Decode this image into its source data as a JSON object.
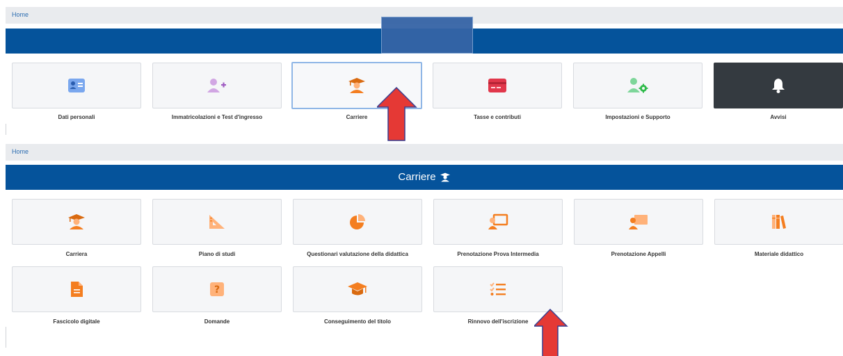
{
  "colors": {
    "header_blue": "#05539b",
    "orange": "#f47e20",
    "purple_accent": "#c58fd8",
    "red_card": "#e1374b",
    "green_gear": "#2fba4a",
    "dark_tile": "#343a40",
    "arrow_red": "#e53935"
  },
  "top": {
    "breadcrumb": "Home",
    "tiles": [
      {
        "label": "Dati personali",
        "icon": "id-card-icon"
      },
      {
        "label": "Immatricolazioni e Test d'ingresso",
        "icon": "add-user-icon"
      },
      {
        "label": "Carriere",
        "icon": "graduate-icon"
      },
      {
        "label": "Tasse e contributi",
        "icon": "credit-card-icon"
      },
      {
        "label": "Impostazioni e Supporto",
        "icon": "user-gear-icon"
      },
      {
        "label": "Avvisi",
        "icon": "bell-icon"
      }
    ]
  },
  "bottom": {
    "breadcrumb": "Home",
    "header_title": "Carriere",
    "row1": [
      {
        "label": "Carriera",
        "icon": "graduate-icon"
      },
      {
        "label": "Piano di studi",
        "icon": "set-square-icon"
      },
      {
        "label": "Questionari valutazione della didattica",
        "icon": "pie-chart-icon"
      },
      {
        "label": "Prenotazione Prova Intermedia",
        "icon": "teacher-board-icon"
      },
      {
        "label": "Prenotazione Appelli",
        "icon": "teacher-board-filled-icon"
      },
      {
        "label": "Materiale didattico",
        "icon": "books-icon"
      }
    ],
    "row2": [
      {
        "label": "Fascicolo digitale",
        "icon": "file-icon"
      },
      {
        "label": "Domande",
        "icon": "question-icon"
      },
      {
        "label": "Conseguimento del titolo",
        "icon": "graduation-cap-icon"
      },
      {
        "label": "Rinnovo dell'iscrizione",
        "icon": "checklist-icon"
      }
    ]
  }
}
